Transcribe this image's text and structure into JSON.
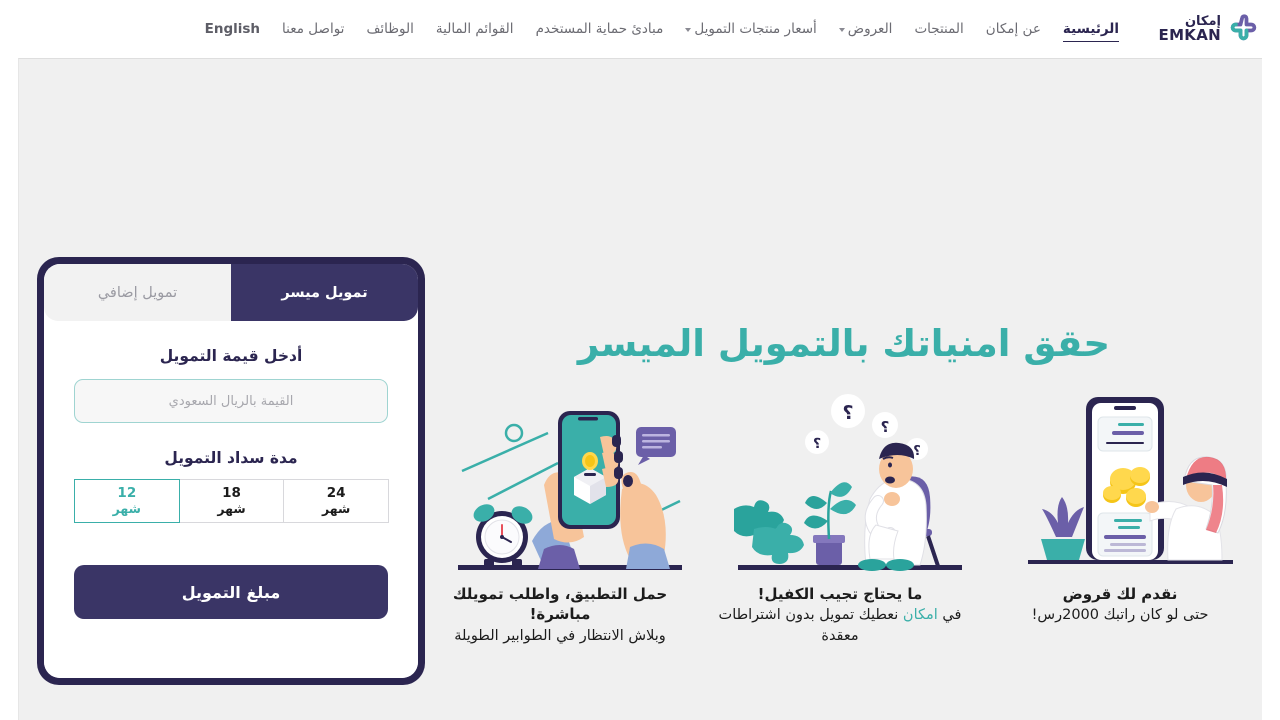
{
  "brand": {
    "name_ar": "إمكان",
    "name_en": "EMKAN",
    "logo_icon": "emkan-logo-icon",
    "navy": "#2b2550",
    "teal": "#3aafa9"
  },
  "nav": {
    "items": [
      {
        "label": "الرئيسية",
        "active": true,
        "caret": false
      },
      {
        "label": "عن إمكان",
        "active": false,
        "caret": false
      },
      {
        "label": "المنتجات",
        "active": false,
        "caret": true
      },
      {
        "label": "العروض",
        "active": false,
        "caret": true
      },
      {
        "label": "أسعار منتجات التمويل",
        "active": false,
        "caret": false
      },
      {
        "label": "مبادئ حماية المستخدم",
        "active": false,
        "caret": false
      },
      {
        "label": "القوائم المالية",
        "active": false,
        "caret": false
      },
      {
        "label": "الوظائف",
        "active": false,
        "caret": false
      },
      {
        "label": "تواصل معنا",
        "active": false,
        "caret": false
      },
      {
        "label": "English",
        "active": false,
        "caret": false
      }
    ]
  },
  "hero": {
    "headline": "حقق امنياتك بالتمويل الميسر"
  },
  "features": [
    {
      "art": "phone-app-chat-illustration",
      "title": "حمل التطبيق، واطلب تمويلك مباشرة!",
      "sub_before": "وبلاش الانتظار في الطوابير الطويلة",
      "sub_highlight": "",
      "sub_after": ""
    },
    {
      "art": "thinking-man-puzzle-illustration",
      "title": "ما يحتاج تجيب الكفيل!",
      "sub_before": "في ",
      "sub_highlight": "امكان",
      "sub_after": " نعطيك تمويل بدون اشتراطات معقدة"
    },
    {
      "art": "phone-coins-man-illustration",
      "title": "نقدم لك قروض",
      "sub_before": "حتى لو كان راتبك 2000رس!",
      "sub_highlight": "",
      "sub_after": ""
    }
  ],
  "calculator": {
    "tabs": [
      {
        "label": "تمويل ميسر",
        "active": true
      },
      {
        "label": "تمويل إضافي",
        "active": false
      }
    ],
    "amount_label": "أدخل قيمة التمويل",
    "amount_value": "",
    "amount_placeholder": "القيمة بالريال السعودي",
    "term_label": "مدة سداد التمويل",
    "terms": [
      {
        "number": "24",
        "unit": "شهر",
        "selected": false
      },
      {
        "number": "18",
        "unit": "شهر",
        "selected": false
      },
      {
        "number": "12",
        "unit": "شهر",
        "selected": true
      }
    ],
    "submit_label": "مبلغ التمويل"
  }
}
